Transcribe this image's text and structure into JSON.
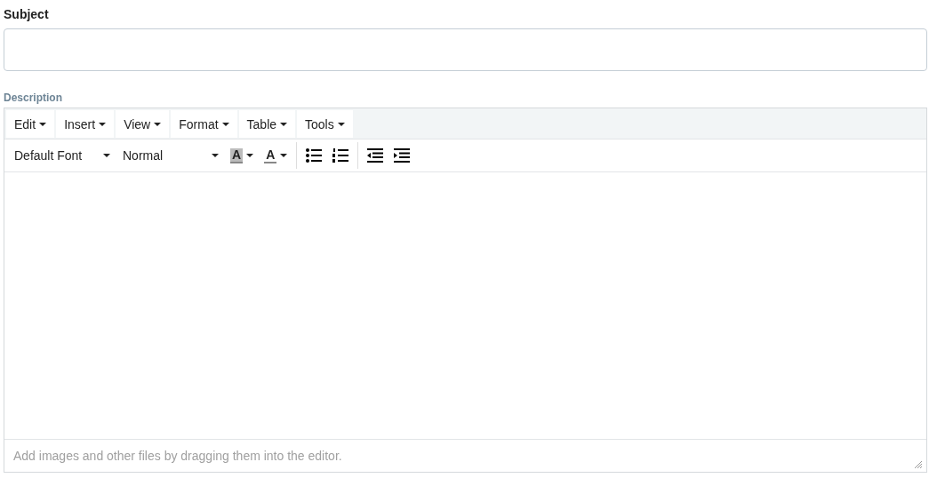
{
  "subject": {
    "label": "Subject"
  },
  "description": {
    "label": "Description",
    "menus": [
      "Edit",
      "Insert",
      "View",
      "Format",
      "Table",
      "Tools"
    ],
    "font_select": "Default Font",
    "size_select": "Normal",
    "highlight_button": "A",
    "text_color_button": "A",
    "status_text": "Add images and other files by dragging them into the editor."
  }
}
